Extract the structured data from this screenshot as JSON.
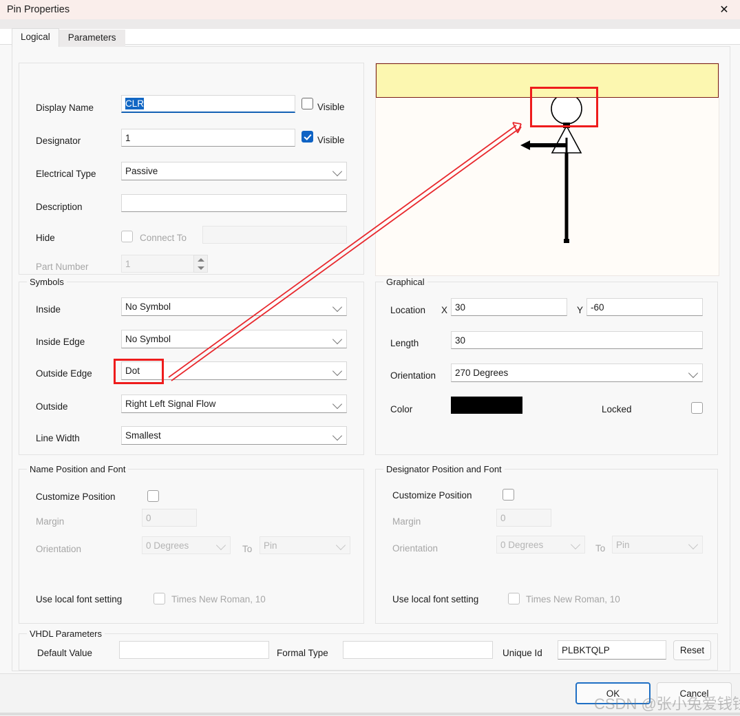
{
  "window": {
    "title": "Pin Properties",
    "close_icon": "close-icon"
  },
  "tabs": [
    {
      "label": "Logical",
      "active": true
    },
    {
      "label": "Parameters",
      "active": false
    }
  ],
  "logical": {
    "display_name": {
      "label": "Display Name",
      "value": "CLR",
      "visible_label": "Visible",
      "visible_checked": false
    },
    "designator": {
      "label": "Designator",
      "value": "1",
      "visible_label": "Visible",
      "visible_checked": true
    },
    "electrical_type": {
      "label": "Electrical Type",
      "value": "Passive"
    },
    "description": {
      "label": "Description",
      "value": ""
    },
    "hide": {
      "label": "Hide",
      "checked": false,
      "connect_to_label": "Connect To",
      "connect_to_value": ""
    },
    "part_number": {
      "label": "Part Number",
      "value": "1"
    }
  },
  "symbols": {
    "title": "Symbols",
    "inside": {
      "label": "Inside",
      "value": "No Symbol"
    },
    "inside_edge": {
      "label": "Inside Edge",
      "value": "No Symbol"
    },
    "outside_edge": {
      "label": "Outside Edge",
      "value": "Dot"
    },
    "outside": {
      "label": "Outside",
      "value": "Right Left Signal Flow"
    },
    "line_width": {
      "label": "Line Width",
      "value": "Smallest"
    }
  },
  "graphical": {
    "title": "Graphical",
    "location_label": "Location",
    "x_label": "X",
    "x_value": "30",
    "y_label": "Y",
    "y_value": "-60",
    "length_label": "Length",
    "length_value": "30",
    "orientation_label": "Orientation",
    "orientation_value": "270 Degrees",
    "color_label": "Color",
    "color_value": "#000000",
    "locked_label": "Locked",
    "locked_checked": false
  },
  "name_position": {
    "title": "Name Position and Font",
    "customize_label": "Customize Position",
    "customize_checked": false,
    "margin_label": "Margin",
    "margin_value": "0",
    "orientation_label": "Orientation",
    "orientation_value": "0 Degrees",
    "to_label": "To",
    "to_value": "Pin",
    "font_setting_label": "Use local font setting",
    "font_checked": false,
    "font_value": "Times New Roman, 10"
  },
  "designator_position": {
    "title": "Designator Position and Font",
    "customize_label": "Customize Position",
    "customize_checked": false,
    "margin_label": "Margin",
    "margin_value": "0",
    "orientation_label": "Orientation",
    "orientation_value": "0 Degrees",
    "to_label": "To",
    "to_value": "Pin",
    "font_setting_label": "Use local font setting",
    "font_checked": false,
    "font_value": "Times New Roman, 10"
  },
  "vhdl": {
    "title": "VHDL Parameters",
    "default_value_label": "Default Value",
    "default_value": "",
    "formal_type_label": "Formal Type",
    "formal_type_value": "",
    "unique_id_label": "Unique Id",
    "unique_id_value": "PLBKTQLP",
    "reset_label": "Reset"
  },
  "footer": {
    "ok_label": "OK",
    "cancel_label": "Cancel"
  },
  "annotations": {
    "watermark": "CSDN @张小兔爱钱钱",
    "highlight_color": "#ee1c1c"
  },
  "preview": {
    "band_color": "#fcf7b0",
    "band_border": "#7a1c14"
  }
}
